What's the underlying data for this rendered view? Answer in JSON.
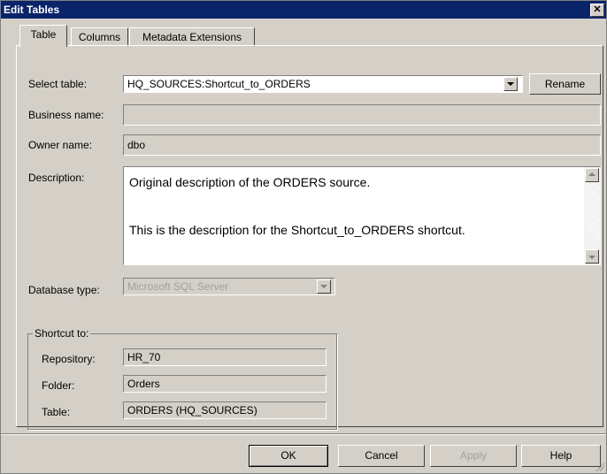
{
  "window": {
    "title": "Edit Tables",
    "close": "✕"
  },
  "tabs": [
    "Table",
    "Columns",
    "Metadata Extensions"
  ],
  "form": {
    "select_table_label": "Select table:",
    "select_table_value": "HQ_SOURCES:Shortcut_to_ORDERS",
    "rename_label": "Rename",
    "business_name_label": "Business name:",
    "business_name_value": "",
    "owner_name_label": "Owner name:",
    "owner_name_value": "dbo",
    "description_label": "Description:",
    "description_line1": "Original description of the ORDERS source.",
    "description_line2": "This is the description for the Shortcut_to_ORDERS shortcut.",
    "database_type_label": "Database type:",
    "database_type_value": "Microsoft SQL Server"
  },
  "shortcut": {
    "legend": "Shortcut to:",
    "repository_label": "Repository:",
    "repository_value": "HR_70",
    "folder_label": "Folder:",
    "folder_value": "Orders",
    "table_label": "Table:",
    "table_value": "ORDERS (HQ_SOURCES)"
  },
  "buttons": {
    "ok": "OK",
    "cancel": "Cancel",
    "apply": "Apply",
    "help": "Help"
  },
  "icons": [
    "close-icon",
    "dropdown-arrow-icon",
    "scroll-up-icon",
    "scroll-down-icon",
    "resize-grip-icon"
  ],
  "colors": {
    "titlebar": "#0a246a",
    "dialog": "#d4d0c8"
  }
}
